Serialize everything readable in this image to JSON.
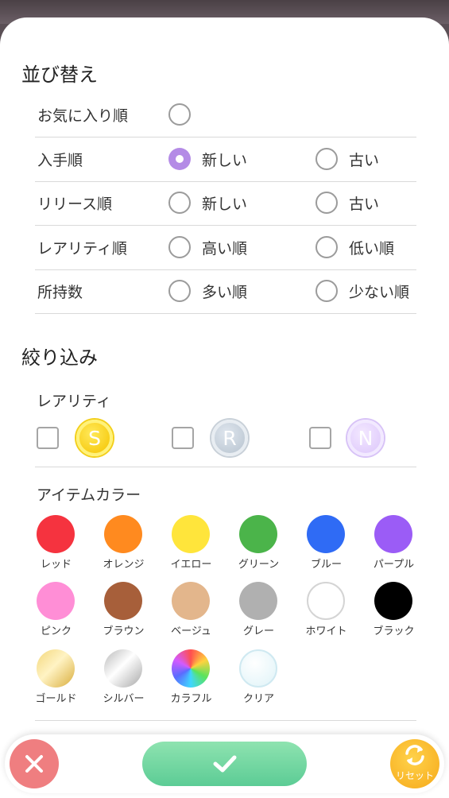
{
  "sort": {
    "title": "並び替え",
    "rows": [
      {
        "label": "お気に入り順",
        "options": [
          {
            "label": "",
            "selected": false
          }
        ]
      },
      {
        "label": "入手順",
        "options": [
          {
            "label": "新しい",
            "selected": true
          },
          {
            "label": "古い",
            "selected": false
          }
        ]
      },
      {
        "label": "リリース順",
        "options": [
          {
            "label": "新しい",
            "selected": false
          },
          {
            "label": "古い",
            "selected": false
          }
        ]
      },
      {
        "label": "レアリティ順",
        "options": [
          {
            "label": "高い順",
            "selected": false
          },
          {
            "label": "低い順",
            "selected": false
          }
        ]
      },
      {
        "label": "所持数",
        "options": [
          {
            "label": "多い順",
            "selected": false
          },
          {
            "label": "少ない順",
            "selected": false
          }
        ]
      }
    ]
  },
  "filter": {
    "title": "絞り込み",
    "rarity": {
      "title": "レアリティ",
      "items": [
        {
          "letter": "S",
          "checked": false,
          "color": "#f5c400"
        },
        {
          "letter": "R",
          "checked": false,
          "color": "#b7c3cf"
        },
        {
          "letter": "N",
          "checked": false,
          "color": "#dcc6fb"
        }
      ]
    },
    "colors": {
      "title": "アイテムカラー",
      "items": [
        {
          "label": "レッド",
          "color": "#f5333f"
        },
        {
          "label": "オレンジ",
          "color": "#ff8a1f"
        },
        {
          "label": "イエロー",
          "color": "#ffe53b"
        },
        {
          "label": "グリーン",
          "color": "#4bb44a"
        },
        {
          "label": "ブルー",
          "color": "#2f6bf5"
        },
        {
          "label": "パープル",
          "color": "#9b5cf6"
        },
        {
          "label": "ピンク",
          "color": "#ff8ed6"
        },
        {
          "label": "ブラウン",
          "color": "#a75f3a"
        },
        {
          "label": "ベージュ",
          "color": "#e3b68c"
        },
        {
          "label": "グレー",
          "color": "#b0b0b0"
        },
        {
          "label": "ホワイト",
          "color": "#ffffff"
        },
        {
          "label": "ブラック",
          "color": "#000000"
        },
        {
          "label": "ゴールド",
          "color": "#e8c65a"
        },
        {
          "label": "シルバー",
          "color": "#c8c8c8"
        },
        {
          "label": "カラフル",
          "color": "multicolor"
        },
        {
          "label": "クリア",
          "color": "#e6f6fb"
        }
      ]
    }
  },
  "actions": {
    "reset_label": "リセット",
    "cancel_icon": "close-icon",
    "confirm_icon": "check-icon",
    "reset_icon": "refresh-icon"
  }
}
